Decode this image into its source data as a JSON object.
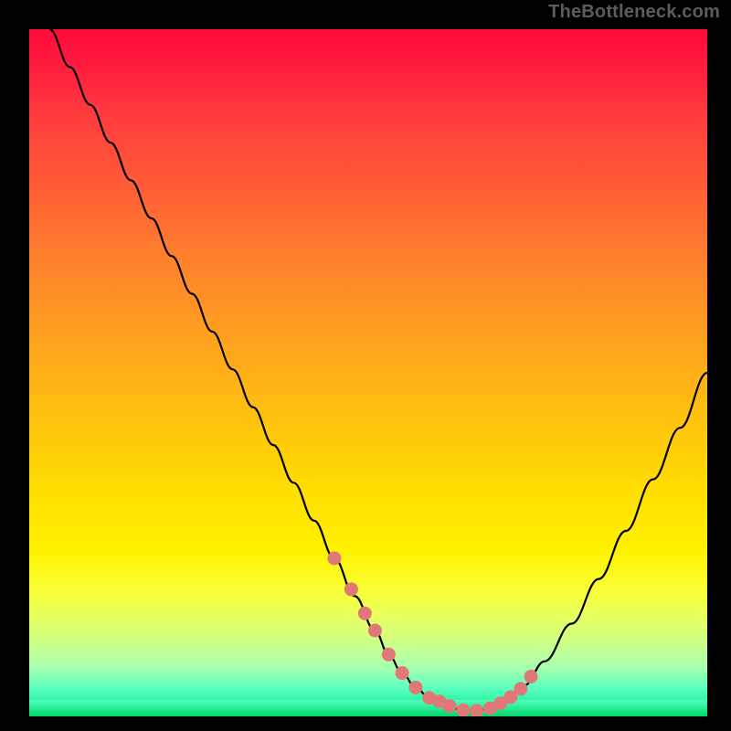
{
  "watermark": "TheBottleneck.com",
  "chart_data": {
    "type": "line",
    "title": "",
    "xlabel": "",
    "ylabel": "",
    "xlim": [
      0,
      100
    ],
    "ylim": [
      0,
      100
    ],
    "grid": false,
    "legend": false,
    "background": "red-yellow-green vertical gradient (bottleneck severity)",
    "series": [
      {
        "name": "bottleneck-curve",
        "x": [
          3,
          6,
          9,
          12,
          15,
          18,
          21,
          24,
          27,
          30,
          33,
          36,
          39,
          42,
          45,
          48,
          51,
          53,
          55,
          57,
          59,
          60,
          62,
          64,
          66,
          68,
          70,
          73,
          76,
          80,
          84,
          88,
          92,
          96,
          100
        ],
        "y": [
          100,
          94.5,
          89,
          83.5,
          78,
          72.5,
          67,
          61.5,
          56,
          50.5,
          45,
          39.5,
          34,
          28.5,
          23,
          17.5,
          12.5,
          9,
          6.3,
          4.2,
          2.7,
          2.1,
          1.3,
          0.9,
          0.8,
          1.2,
          2.2,
          4.5,
          8,
          13.5,
          20,
          27,
          34.5,
          42,
          50
        ]
      }
    ],
    "highlighted_points": {
      "name": "sweet-spot-dots",
      "color": "#e07878",
      "x": [
        45,
        47.5,
        49.5,
        51,
        53,
        55,
        57,
        59,
        60.5,
        62,
        64,
        66,
        68,
        69.5,
        71,
        72.5,
        74
      ],
      "y": [
        23,
        18.5,
        15,
        12.5,
        9,
        6.3,
        4.2,
        2.7,
        2.2,
        1.5,
        0.9,
        0.8,
        1.2,
        1.9,
        2.8,
        4.0,
        5.8
      ]
    }
  }
}
